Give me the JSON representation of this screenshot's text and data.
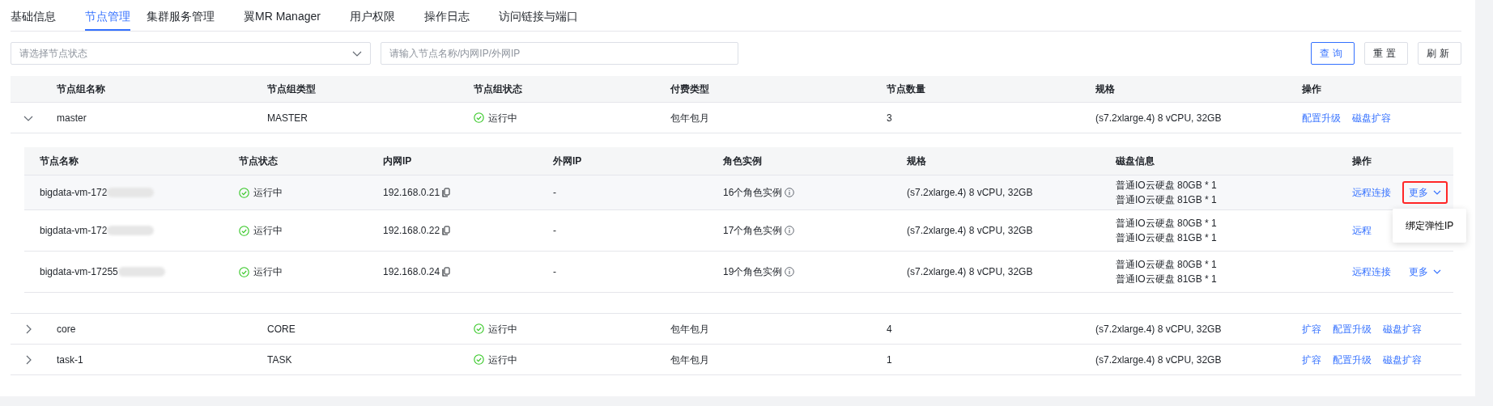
{
  "tabs": [
    {
      "label": "基础信息",
      "selected": false
    },
    {
      "label": "节点管理",
      "selected": true
    },
    {
      "label": "集群服务管理",
      "selected": false
    },
    {
      "label": "翼MR Manager",
      "selected": false
    },
    {
      "label": "用户权限",
      "selected": false
    },
    {
      "label": "操作日志",
      "selected": false
    },
    {
      "label": "访问链接与端口",
      "selected": false
    }
  ],
  "filters": {
    "status_select": {
      "placeholder": "请选择节点状态"
    },
    "search": {
      "placeholder": "请输入节点名称/内网IP/外网IP"
    }
  },
  "buttons": [
    {
      "label": "查询",
      "kind": "primary"
    },
    {
      "label": "重置",
      "kind": "default"
    },
    {
      "label": "刷新",
      "kind": "default"
    }
  ],
  "groups_table": {
    "columns": [
      "节点组名称",
      "节点组类型",
      "节点组状态",
      "付费类型",
      "节点数量",
      "规格",
      "操作"
    ],
    "rows": [
      {
        "expanded": true,
        "name": "master",
        "type": "MASTER",
        "status": "运行中",
        "billing": "包年包月",
        "count": "3",
        "spec": "(s7.2xlarge.4) 8 vCPU, 32GB",
        "actions": [
          "配置升级",
          "磁盘扩容"
        ],
        "nodes": {
          "columns": [
            "节点名称",
            "节点状态",
            "内网IP",
            "外网IP",
            "角色实例",
            "规格",
            "磁盘信息",
            "操作"
          ],
          "rows": [
            {
              "name": "bigdata-vm-172",
              "redacted": true,
              "status": "运行中",
              "ip": "192.168.0.21",
              "public_ip": "-",
              "roles": "16个角色实例",
              "spec": "(s7.2xlarge.4) 8 vCPU, 32GB",
              "disks": [
                "普通IO云硬盘 80GB * 1",
                "普通IO云硬盘 81GB * 1"
              ],
              "hovered": true,
              "actions": [
                {
                  "label": "远程连接",
                  "kind": "link"
                },
                {
                  "label": "更多",
                  "kind": "more",
                  "highlighted": true,
                  "menu": [
                    "绑定弹性IP"
                  ]
                }
              ]
            },
            {
              "name": "bigdata-vm-172",
              "redacted": true,
              "status": "运行中",
              "ip": "192.168.0.22",
              "public_ip": "-",
              "roles": "17个角色实例",
              "spec": "(s7.2xlarge.4) 8 vCPU, 32GB",
              "disks": [
                "普通IO云硬盘 80GB * 1",
                "普通IO云硬盘 81GB * 1"
              ],
              "hovered": false,
              "actions": [
                {
                  "label": "远程",
                  "kind": "link"
                }
              ]
            },
            {
              "name": "bigdata-vm-17255",
              "redacted": true,
              "status": "运行中",
              "ip": "192.168.0.24",
              "public_ip": "-",
              "roles": "19个角色实例",
              "spec": "(s7.2xlarge.4) 8 vCPU, 32GB",
              "disks": [
                "普通IO云硬盘 80GB * 1",
                "普通IO云硬盘 81GB * 1"
              ],
              "hovered": false,
              "actions": [
                {
                  "label": "远程连接",
                  "kind": "link"
                },
                {
                  "label": "更多",
                  "kind": "more",
                  "highlighted": false
                }
              ]
            }
          ]
        }
      },
      {
        "expanded": false,
        "name": "core",
        "type": "CORE",
        "status": "运行中",
        "billing": "包年包月",
        "count": "4",
        "spec": "(s7.2xlarge.4) 8 vCPU, 32GB",
        "actions": [
          "扩容",
          "配置升级",
          "磁盘扩容"
        ]
      },
      {
        "expanded": false,
        "name": "task-1",
        "type": "TASK",
        "status": "运行中",
        "billing": "包年包月",
        "count": "1",
        "spec": "(s7.2xlarge.4) 8 vCPU, 32GB",
        "actions": [
          "扩容",
          "配置升级",
          "磁盘扩容"
        ]
      }
    ]
  }
}
